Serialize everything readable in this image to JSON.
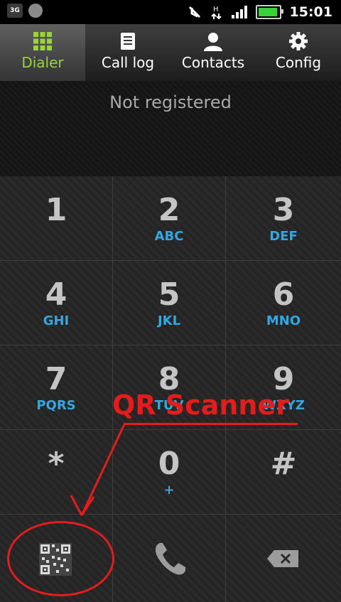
{
  "status_bar": {
    "network": "3G",
    "time": "15:01"
  },
  "tabs": [
    {
      "label": "Dialer",
      "icon": "grid-icon",
      "active": true
    },
    {
      "label": "Call log",
      "icon": "list-icon",
      "active": false
    },
    {
      "label": "Contacts",
      "icon": "person-icon",
      "active": false
    },
    {
      "label": "Config",
      "icon": "gear-icon",
      "active": false
    }
  ],
  "registration": {
    "status": "Not registered"
  },
  "keys": [
    {
      "num": "1",
      "letters": ""
    },
    {
      "num": "2",
      "letters": "ABC"
    },
    {
      "num": "3",
      "letters": "DEF"
    },
    {
      "num": "4",
      "letters": "GHI"
    },
    {
      "num": "5",
      "letters": "JKL"
    },
    {
      "num": "6",
      "letters": "MNO"
    },
    {
      "num": "7",
      "letters": "PQRS"
    },
    {
      "num": "8",
      "letters": "TUV"
    },
    {
      "num": "9",
      "letters": "WXYZ"
    },
    {
      "num": "*",
      "letters": ""
    },
    {
      "num": "0",
      "letters": "+"
    },
    {
      "num": "#",
      "letters": ""
    }
  ],
  "annotation": {
    "label": "QR Scanner",
    "color": "#e41c1c"
  }
}
